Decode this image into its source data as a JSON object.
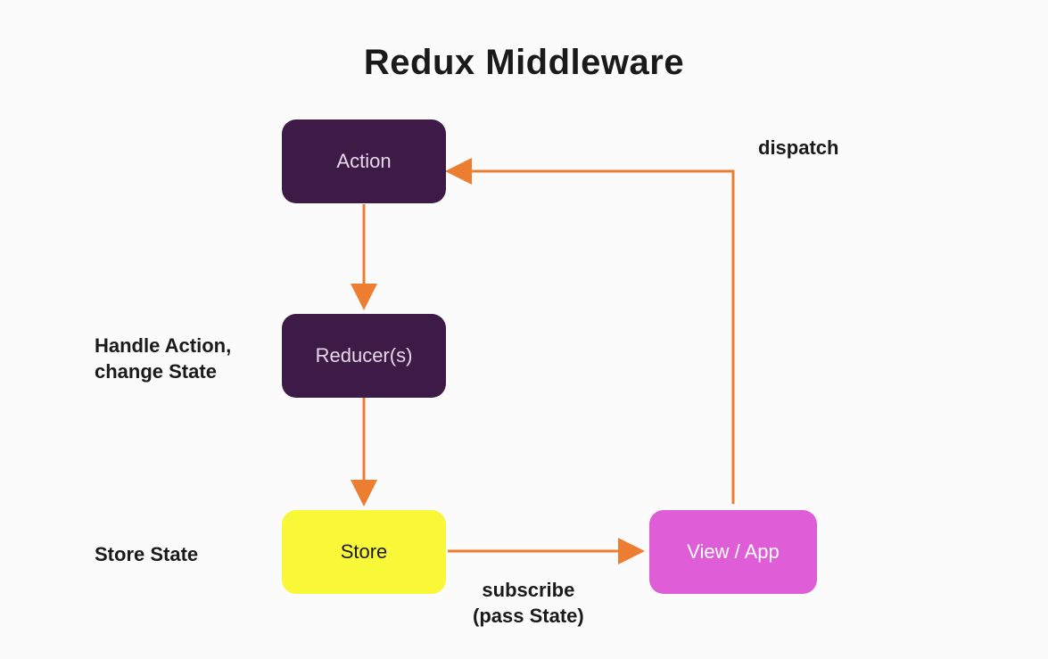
{
  "title": "Redux Middleware",
  "nodes": {
    "action": {
      "label": "Action"
    },
    "reducers": {
      "label": "Reducer(s)"
    },
    "store": {
      "label": "Store"
    },
    "view": {
      "label": "View / App"
    }
  },
  "labels": {
    "handle_action": "Handle Action,\nchange State",
    "store_state": "Store State",
    "subscribe": "subscribe\n(pass State)",
    "dispatch": "dispatch"
  },
  "edges": [
    {
      "from": "action",
      "to": "reducers",
      "direction": "down"
    },
    {
      "from": "reducers",
      "to": "store",
      "direction": "down"
    },
    {
      "from": "store",
      "to": "view",
      "direction": "right",
      "label_key": "subscribe"
    },
    {
      "from": "view",
      "to": "action",
      "direction": "up-left",
      "label_key": "dispatch"
    }
  ],
  "colors": {
    "node_dark": "#3e1b46",
    "node_yellow": "#f8f838",
    "node_pink": "#df5dd6",
    "arrow": "#ed7d31"
  }
}
